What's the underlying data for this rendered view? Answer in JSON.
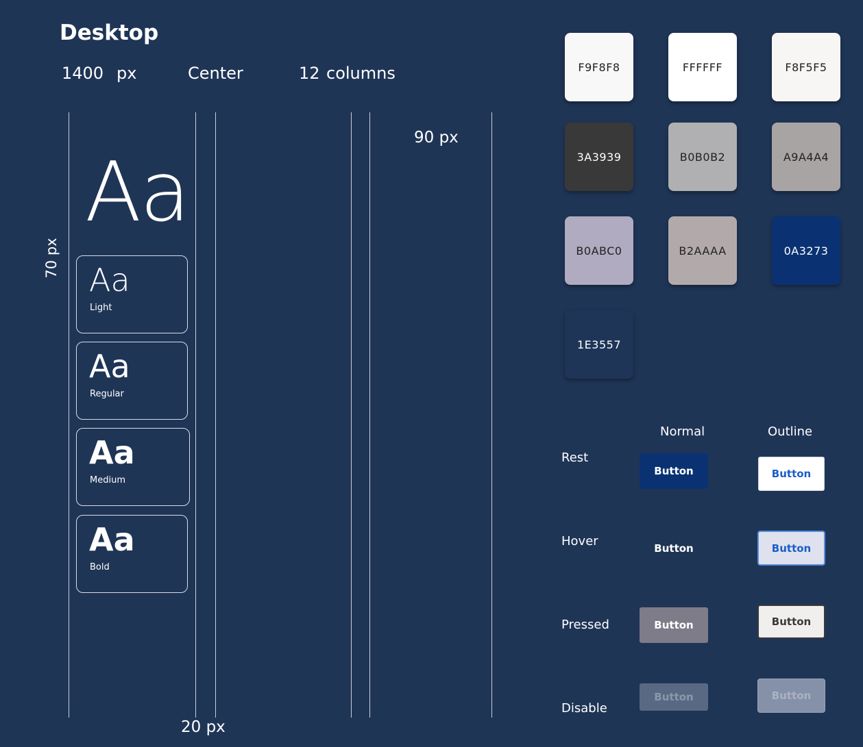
{
  "header": {
    "title": "Desktop",
    "width_value": "1400",
    "width_unit": "px",
    "alignment": "Center",
    "columns_count": "12",
    "columns_label": "columns"
  },
  "grid_labels": {
    "margin": "70 px",
    "gutter": "20 px",
    "column": "90 px"
  },
  "typography": {
    "sample": "Aa",
    "weights": [
      {
        "label": "Light",
        "sample": "Aa"
      },
      {
        "label": "Regular",
        "sample": "Aa"
      },
      {
        "label": "Medium",
        "sample": "Aa"
      },
      {
        "label": "Bold",
        "sample": "Aa"
      }
    ]
  },
  "palette": [
    {
      "label": "F9F8F8",
      "color": "#F9F8F8",
      "text_color": "#222222"
    },
    {
      "label": "FFFFFF",
      "color": "#FFFFFF",
      "text_color": "#222222"
    },
    {
      "label": "F8F5F5",
      "color": "#F8F5F5",
      "text_color": "#222222"
    },
    {
      "label": "3A3939",
      "color": "#3A3939",
      "text_color": "#FFFFFF"
    },
    {
      "label": "B0B0B2",
      "color": "#B0B0B2",
      "text_color": "#222222"
    },
    {
      "label": "A9A4A4",
      "color": "#A9A4A4",
      "text_color": "#222222"
    },
    {
      "label": "B0ABC0",
      "color": "#B0ABC0",
      "text_color": "#222222"
    },
    {
      "label": "B2AAAA",
      "color": "#B2AAAA",
      "text_color": "#222222"
    },
    {
      "label": "0A3273",
      "color": "#0A3273",
      "text_color": "#FFFFFF"
    },
    {
      "label": "1E3557",
      "color": "#1E3557",
      "text_color": "#FFFFFF"
    }
  ],
  "buttons": {
    "columns": [
      "Normal",
      "Outline"
    ],
    "rows": [
      {
        "state": "Rest",
        "normal_label": "Button",
        "outline_label": "Button"
      },
      {
        "state": "Hover",
        "normal_label": "Button",
        "outline_label": "Button"
      },
      {
        "state": "Pressed",
        "normal_label": "Button",
        "outline_label": "Button"
      },
      {
        "state": "Disable",
        "normal_label": "Button",
        "outline_label": "Button"
      }
    ]
  }
}
